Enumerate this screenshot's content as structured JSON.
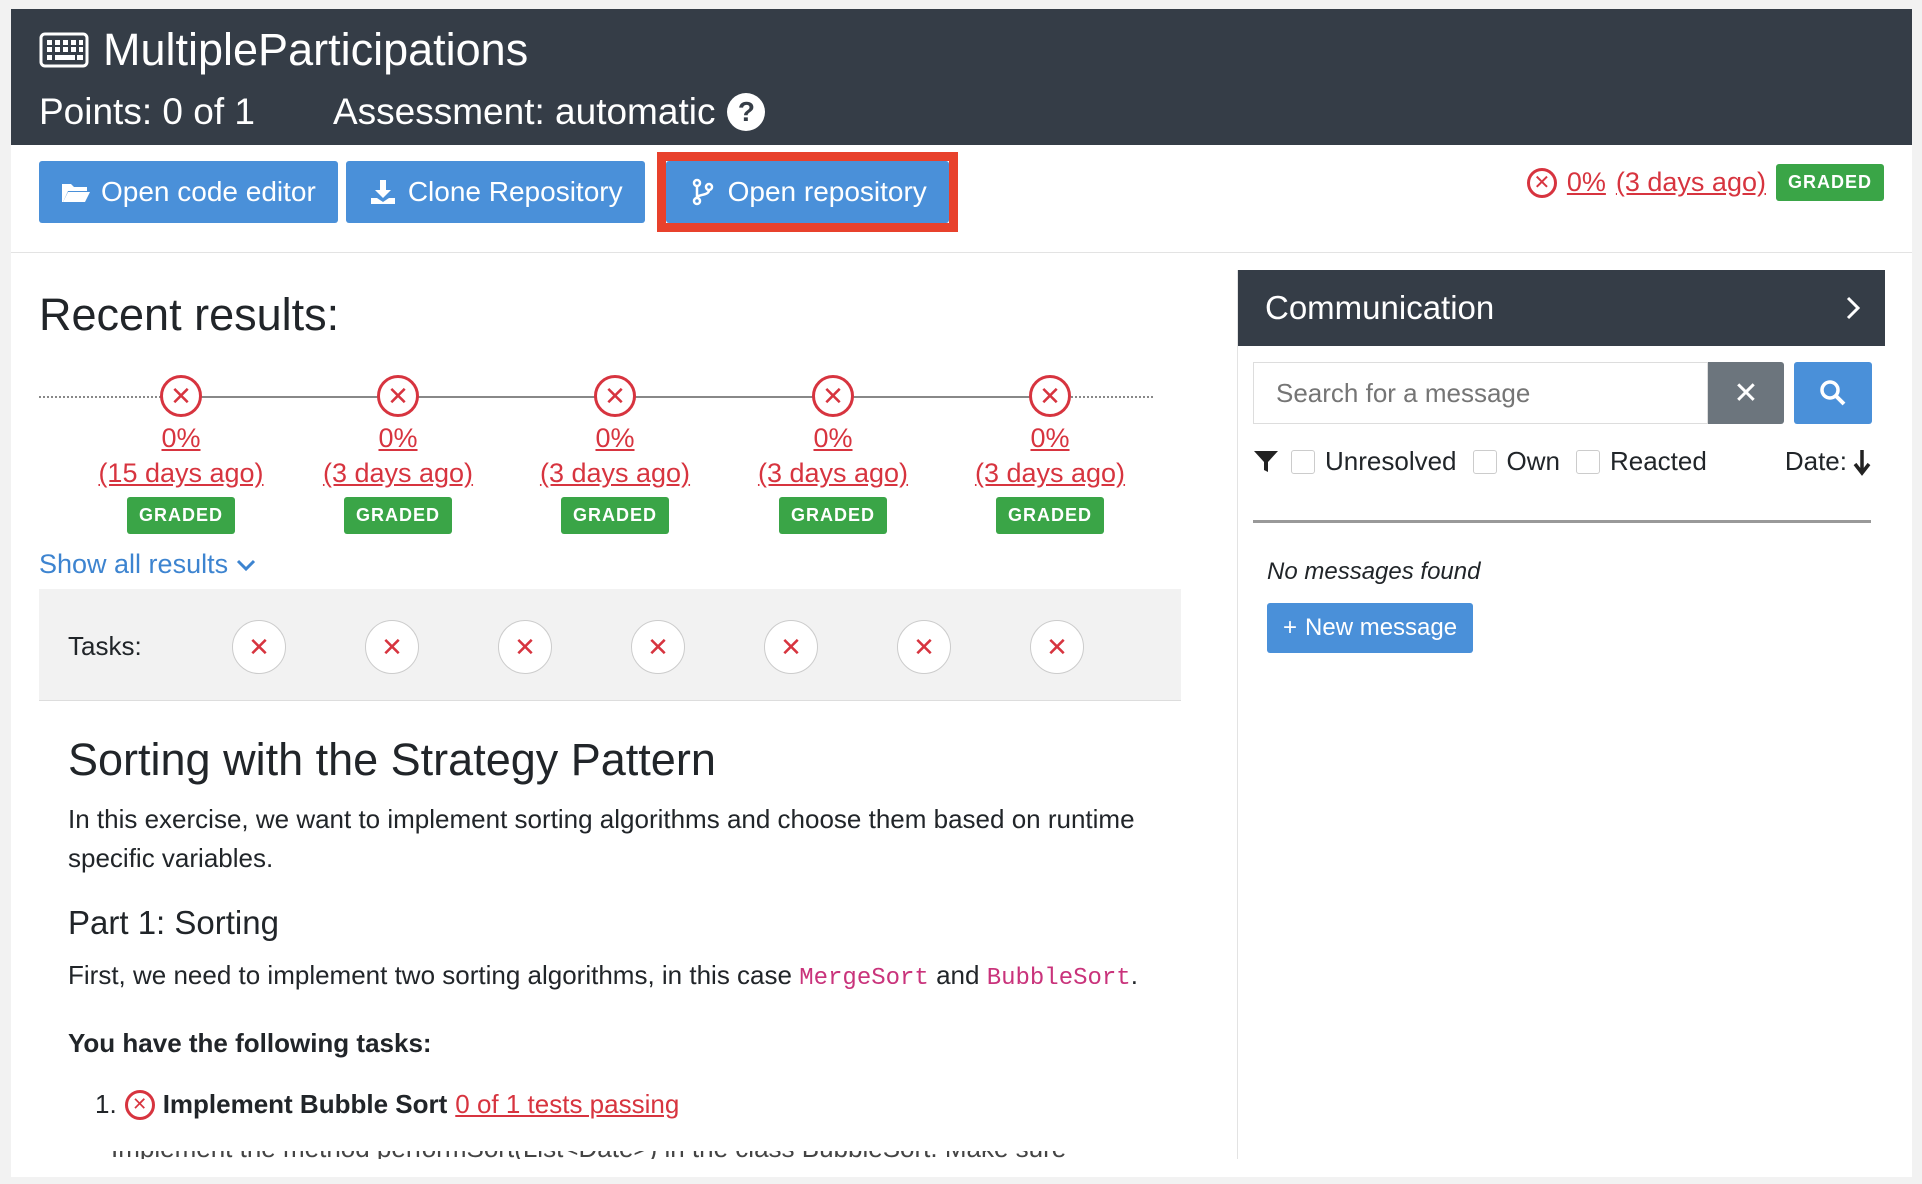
{
  "header": {
    "title": "MultipleParticipations",
    "points": "Points: 0 of 1",
    "assessment": "Assessment: automatic",
    "help_glyph": "?",
    "title_icon": "keyboard-icon"
  },
  "actions": {
    "open_code_editor": "Open code editor",
    "clone_repository": "Clone Repository",
    "open_repository": "Open repository"
  },
  "latest_result": {
    "percent": "0%",
    "ago": "(3 days ago)",
    "badge": "GRADED"
  },
  "recent_results": {
    "title": "Recent results:",
    "items": [
      {
        "percent": "0%",
        "ago": "(15 days ago)",
        "badge": "GRADED"
      },
      {
        "percent": "0%",
        "ago": "(3 days ago)",
        "badge": "GRADED"
      },
      {
        "percent": "0%",
        "ago": "(3 days ago)",
        "badge": "GRADED"
      },
      {
        "percent": "0%",
        "ago": "(3 days ago)",
        "badge": "GRADED"
      },
      {
        "percent": "0%",
        "ago": "(3 days ago)",
        "badge": "GRADED"
      }
    ],
    "show_all": "Show all results"
  },
  "tasks": {
    "label": "Tasks:",
    "count": 7,
    "glyph": "✕"
  },
  "problem": {
    "title": "Sorting with the Strategy Pattern",
    "intro": "In this exercise, we want to implement sorting algorithms and choose them based on runtime specific variables.",
    "part1_title": "Part 1: Sorting",
    "part1_text_before": "First, we need to implement two sorting algorithms, in this case",
    "code_merge": "MergeSort",
    "part1_and": "and",
    "code_bubble": "BubbleSort",
    "part1_end": ".",
    "tasks_heading": "You have the following tasks:",
    "task1_number": "1.",
    "task1_title": "Implement Bubble Sort",
    "task1_tests": "0 of 1 tests passing",
    "task1_cut": "Implement the method performSort(List<Date>) in the class BubbleSort. Make sure"
  },
  "communication": {
    "title": "Communication",
    "search_placeholder": "Search for a message",
    "filters": [
      "Unresolved",
      "Own",
      "Reacted"
    ],
    "date_label": "Date:",
    "no_messages": "No messages found",
    "new_message": "New message"
  },
  "colors": {
    "header_bg": "#353d47",
    "primary": "#4a90d9",
    "danger": "#d7343f",
    "success": "#3aa547",
    "highlight": "#e8412c"
  }
}
